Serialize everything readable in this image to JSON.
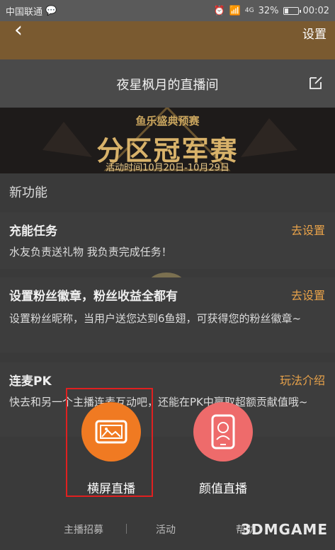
{
  "status_bar": {
    "carrier": "中国联通",
    "signal": "4G",
    "battery_percent": "32%",
    "battery_level": 0.32,
    "time": "00:02"
  },
  "nav": {
    "settings_label": "设置"
  },
  "room": {
    "title": "夜星枫月的直播间"
  },
  "banner": {
    "subtitle": "鱼乐盛典预赛",
    "title": "分区冠军赛",
    "date": "活动时间10月20日-10月29日"
  },
  "section": {
    "title": "新功能"
  },
  "features": [
    {
      "title": "充能任务",
      "action": "去设置",
      "desc": "水友负责送礼物 我负责完成任务！"
    },
    {
      "title": "设置粉丝徽章，粉丝收益全都有",
      "action": "去设置",
      "desc": "设置粉丝昵称，当用户送您达到6鱼翅，可获得您的粉丝徽章~"
    },
    {
      "title": "连麦PK",
      "action": "玩法介绍",
      "desc": "快去和另一个主播连麦互动吧，还能在PK中赢取超额贡献值哦~"
    }
  ],
  "live_options": {
    "landscape": "横屏直播",
    "portrait": "颜值直播"
  },
  "bottom_links": {
    "recruit": "主播招募",
    "activity": "活动",
    "help": "帮助"
  },
  "watermark": "3DMGAME",
  "colors": {
    "accent_orange": "#f07a22",
    "accent_pink": "#ee6b6b",
    "action_orange": "#e8a24a",
    "highlight_red": "#e02020"
  }
}
